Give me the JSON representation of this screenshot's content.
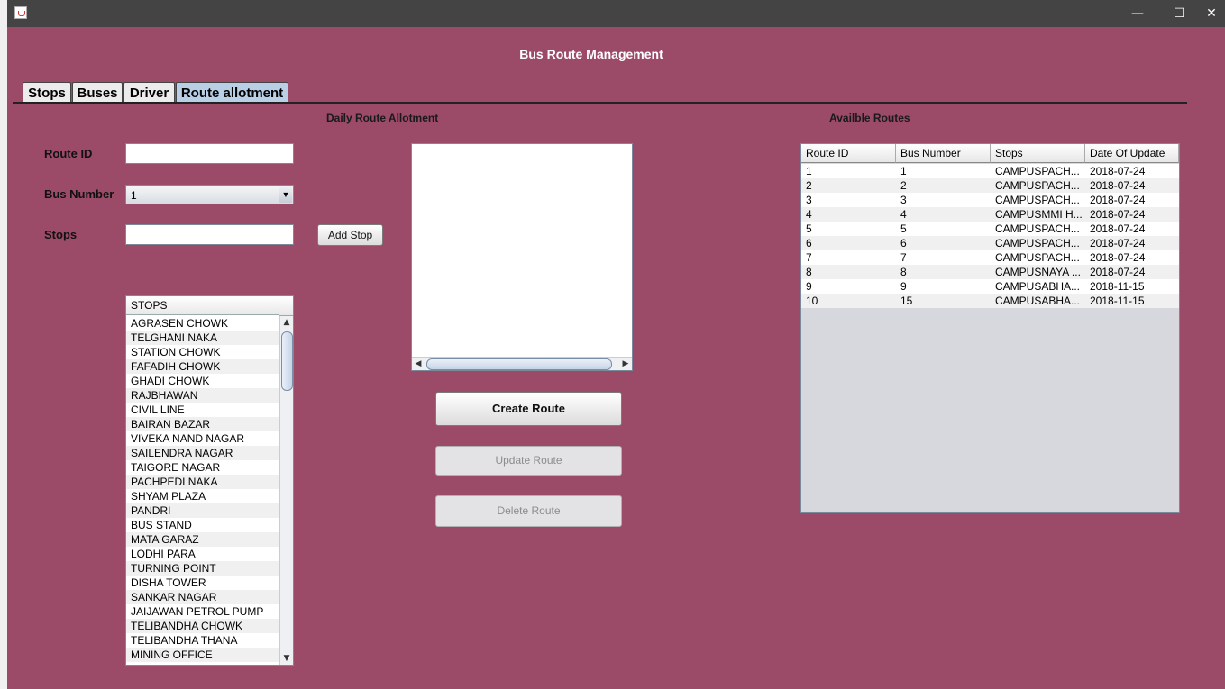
{
  "window": {
    "title": "",
    "minimize": "—",
    "maximize": "☐",
    "close": "✕"
  },
  "app": {
    "heading": "Bus Route Management"
  },
  "tabs": [
    {
      "label": "Stops"
    },
    {
      "label": "Buses"
    },
    {
      "label": "Driver"
    },
    {
      "label": "Route allotment"
    }
  ],
  "allotment": {
    "title": "Daily Route Allotment",
    "route_id_label": "Route ID",
    "route_id_value": "",
    "bus_number_label": "Bus Number",
    "bus_number_value": "1",
    "stops_label": "Stops",
    "stops_value": "",
    "add_stop_button": "Add Stop",
    "stops_table_header": "STOPS",
    "stops": [
      "AGRASEN CHOWK",
      "TELGHANI NAKA",
      "STATION CHOWK",
      "FAFADIH CHOWK",
      "GHADI CHOWK",
      "RAJBHAWAN",
      "CIVIL LINE",
      "BAIRAN BAZAR",
      "VIVEKA NAND NAGAR",
      "SAILENDRA NAGAR",
      "TAIGORE NAGAR",
      "PACHPEDI NAKA",
      "SHYAM PLAZA",
      "PANDRI",
      "BUS STAND",
      "MATA GARAZ",
      "LODHI PARA",
      "TURNING POINT",
      "DISHA TOWER",
      "SANKAR NAGAR",
      "JAIJAWAN PETROL PUMP",
      "TELIBANDHA CHOWK",
      "TELIBANDHA THANA",
      "MINING OFFICE"
    ],
    "create_button": "Create Route",
    "update_button": "Update Route",
    "delete_button": "Delete Route"
  },
  "routes": {
    "title": "Availble Routes",
    "columns": [
      "Route ID",
      "Bus Number",
      "Stops",
      "Date Of Update"
    ],
    "rows": [
      [
        "1",
        "1",
        "CAMPUSPACH...",
        "2018-07-24"
      ],
      [
        "2",
        "2",
        "CAMPUSPACH...",
        "2018-07-24"
      ],
      [
        "3",
        "3",
        "CAMPUSPACH...",
        "2018-07-24"
      ],
      [
        "4",
        "4",
        "CAMPUSMMI H...",
        "2018-07-24"
      ],
      [
        "5",
        "5",
        "CAMPUSPACH...",
        "2018-07-24"
      ],
      [
        "6",
        "6",
        "CAMPUSPACH...",
        "2018-07-24"
      ],
      [
        "7",
        "7",
        "CAMPUSPACH...",
        "2018-07-24"
      ],
      [
        "8",
        "8",
        "CAMPUSNAYA ...",
        "2018-07-24"
      ],
      [
        "9",
        "9",
        "CAMPUSABHA...",
        "2018-11-15"
      ],
      [
        "10",
        "15",
        "CAMPUSABHA...",
        "2018-11-15"
      ]
    ]
  },
  "colors": {
    "background": "#9b4a67",
    "titlebar": "#444444",
    "active_tab": "#b8cfe5"
  }
}
